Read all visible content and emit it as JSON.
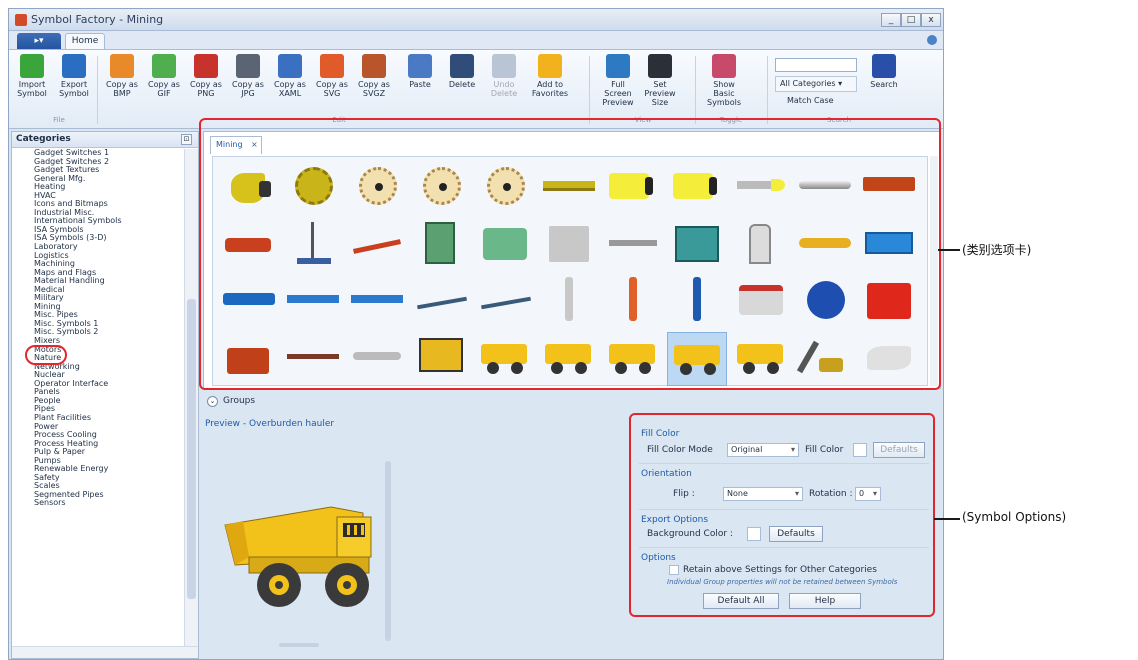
{
  "window": {
    "title": "Symbol Factory - Mining",
    "min": "_",
    "max": "□",
    "close": "x"
  },
  "ribbon": {
    "tab_home": "Home",
    "buttons": [
      {
        "id": "import-symbol",
        "label": "Import Symbol",
        "icon": "download-arrow-icon",
        "color": "#3aa53a"
      },
      {
        "id": "export-symbol",
        "label": "Export Symbol",
        "icon": "upload-arrow-icon",
        "color": "#2a6ec1"
      },
      {
        "id": "copy-bmp",
        "label": "Copy as BMP",
        "icon": "paint-palette-icon",
        "color": "#e8892a"
      },
      {
        "id": "copy-gif",
        "label": "Copy as GIF",
        "icon": "gif-file-icon",
        "color": "#4faf4f"
      },
      {
        "id": "copy-png",
        "label": "Copy as PNG",
        "icon": "png-file-icon",
        "color": "#c8322d"
      },
      {
        "id": "copy-jpg",
        "label": "Copy as JPG",
        "icon": "jpg-file-icon",
        "color": "#5a6472"
      },
      {
        "id": "copy-xaml",
        "label": "Copy as XAML",
        "icon": "xaml-icon",
        "color": "#3b6fc1"
      },
      {
        "id": "copy-svg",
        "label": "Copy as SVG",
        "icon": "svg-file-icon",
        "color": "#e05a2a"
      },
      {
        "id": "copy-svgz",
        "label": "Copy as SVGZ",
        "icon": "svgz-file-icon",
        "color": "#b8552a"
      },
      {
        "id": "paste",
        "label": "Paste",
        "icon": "paste-clipboard-icon",
        "color": "#4a7ac4"
      },
      {
        "id": "delete",
        "label": "Delete",
        "icon": "trash-icon",
        "color": "#2f4d78"
      },
      {
        "id": "undo-delete",
        "label": "Undo Delete",
        "icon": "undo-icon",
        "color": "#b9c4d4"
      },
      {
        "id": "add-favorites",
        "label": "Add to Favorites",
        "icon": "star-icon",
        "color": "#f2b21e"
      },
      {
        "id": "full-screen",
        "label": "Full Screen Preview",
        "icon": "fullscreen-icon",
        "color": "#2e7ac2"
      },
      {
        "id": "preview-size",
        "label": "Set Preview Size",
        "icon": "camera-icon",
        "color": "#2b2f38"
      },
      {
        "id": "show-basic",
        "label": "Show Basic Symbols",
        "icon": "symbols-icon",
        "color": "#c84a6a"
      }
    ],
    "groups": {
      "file": "File",
      "edit": "Edit",
      "view": "View",
      "toggle": "Toggle",
      "search": "Search"
    },
    "search": {
      "category": "All Categories",
      "match_case": "Match Case",
      "button": "Search"
    }
  },
  "categories": {
    "header": "Categories",
    "items": [
      "Gadget Switches 1",
      "Gadget Switches 2",
      "Gadget Textures",
      "General Mfg.",
      "Heating",
      "HVAC",
      "Icons and Bitmaps",
      "Industrial Misc.",
      "International Symbols",
      "ISA Symbols",
      "ISA Symbols (3-D)",
      "Laboratory",
      "Logistics",
      "Machining",
      "Maps and Flags",
      "Material Handling",
      "Medical",
      "Military",
      "Mining",
      "Misc. Pipes",
      "Misc. Symbols 1",
      "Misc. Symbols 2",
      "Mixers",
      "Motors",
      "Nature",
      "Networking",
      "Nuclear",
      "Operator Interface",
      "Panels",
      "People",
      "Pipes",
      "Plant Facilities",
      "Power",
      "Process Cooling",
      "Process Heating",
      "Pulp & Paper",
      "Pumps",
      "Renewable Energy",
      "Safety",
      "Scales",
      "Segmented Pipes",
      "Sensors"
    ],
    "selected": "Mining"
  },
  "symbol_tab": {
    "label": "Mining",
    "close": "×"
  },
  "symbols": {
    "selected_index": 40,
    "rows": [
      [
        "drill-head-icon",
        "gear-disk-icon",
        "cutter-wheel-icon",
        "cutter-wheel-icon",
        "cutter-wheel-icon",
        "conveyor-section-icon",
        "yellow-cylinder-icon",
        "yellow-cylinder-icon",
        "drill-bit-icon",
        "rod-icon",
        "log-icon"
      ],
      [
        "drill-rig-icon",
        "derrick-icon",
        "excavator-arm-icon",
        "green-machine-icon",
        "green-crusher-icon",
        "grey-machine-icon",
        "shaft-icon",
        "teal-unit-icon",
        "separator-icon",
        "yellow-tube-icon",
        "blue-box-icon"
      ],
      [
        "blue-motor-icon",
        "blue-conveyor-icon",
        "blue-conveyor-icon",
        "incline-conveyor-icon",
        "incline-conveyor-icon",
        "grey-drill-icon",
        "orange-drill-icon",
        "blue-drill-icon",
        "grinder-icon",
        "blue-fan-icon",
        "red-unit-icon"
      ],
      [
        "pump-station-icon",
        "belt-icon",
        "roller-icon",
        "loader-truck-icon",
        "dump-truck-icon",
        "dump-truck-icon",
        "dump-truck-icon",
        "dump-truck-icon",
        "dump-truck-icon",
        "shovel-icon",
        "chute-icon"
      ]
    ]
  },
  "groups": {
    "label": "Groups"
  },
  "preview": {
    "label": "Preview - Overburden hauler"
  },
  "options": {
    "fill_color_header": "Fill Color",
    "fill_mode_label": "Fill Color Mode",
    "fill_mode_value": "Original",
    "fill_color_label": "Fill Color",
    "defaults": "Defaults",
    "orientation_header": "Orientation",
    "flip_label": "Flip :",
    "flip_value": "None",
    "rotation_label": "Rotation :",
    "rotation_value": "0",
    "export_header": "Export Options",
    "bg_color_label": "Background Color :",
    "options_header": "Options",
    "retain_label": "Retain above Settings for Other Categories",
    "retain_note": "Individual Group properties will not be retained between Symbols",
    "default_all": "Default All",
    "help": "Help"
  },
  "annotations": {
    "category_tab": "(类别选项卡)",
    "symbol_options": "(Symbol Options)"
  },
  "colors": {
    "accent": "#1e5aa8",
    "annotation_red": "#e0272d",
    "truck_yellow": "#f2c21a"
  }
}
